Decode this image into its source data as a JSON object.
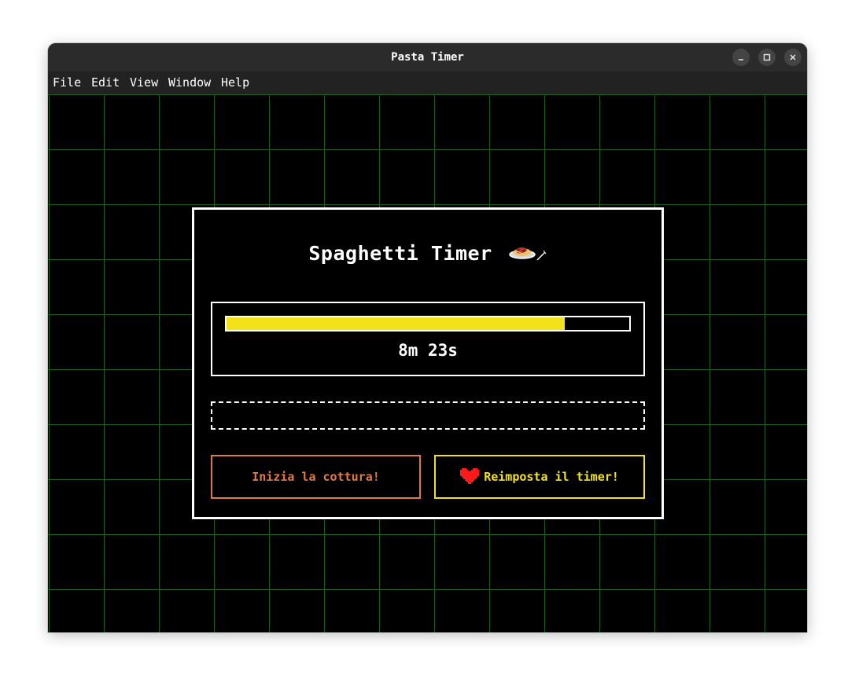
{
  "window": {
    "title": "Pasta Timer",
    "controls": {
      "minimize": "minimize-icon",
      "maximize": "maximize-icon",
      "close": "close-icon"
    }
  },
  "menu": {
    "items": [
      "File",
      "Edit",
      "View",
      "Window",
      "Help"
    ]
  },
  "dialog": {
    "title": "Spaghetti Timer",
    "title_icon": "spaghetti-plate-icon",
    "progress": {
      "fraction": 0.84,
      "fill_color": "#f3e11a"
    },
    "time_remaining": "8m 23s",
    "message": "",
    "buttons": {
      "start": {
        "label": "Inizia la cottura!",
        "color": "#e07a45"
      },
      "reset": {
        "label": "Reimposta il timer!",
        "color": "#f3e11a",
        "icon": "heart-icon",
        "icon_color": "#ff1a1a"
      }
    }
  },
  "colors": {
    "grid_line": "#1f5a1f",
    "background": "#000000",
    "border": "#ffffff"
  }
}
